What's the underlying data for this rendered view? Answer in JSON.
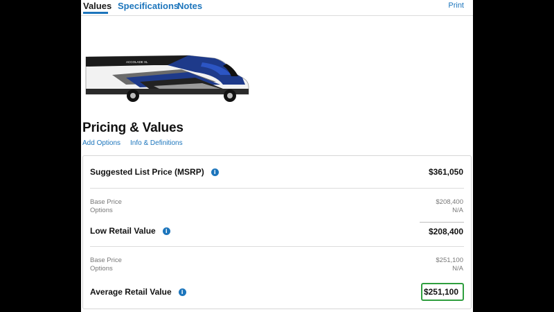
{
  "tabs": [
    {
      "label": "Values",
      "active": true
    },
    {
      "label": "Specifications",
      "active": false
    },
    {
      "label": "Notes",
      "active": false
    }
  ],
  "print_label": "Print",
  "vehicle_image": {
    "brand_text": "ACCOLADE XL"
  },
  "page_title": "Pricing & Values",
  "links": {
    "add_options": "Add Options",
    "info_definitions": "Info & Definitions"
  },
  "pricing": {
    "msrp": {
      "label": "Suggested List Price (MSRP)",
      "value": "$361,050"
    },
    "low": {
      "base_label": "Base Price",
      "base_value": "$208,400",
      "options_label": "Options",
      "options_value": "N/A",
      "label": "Low Retail Value",
      "value": "$208,400"
    },
    "average": {
      "base_label": "Base Price",
      "base_value": "$251,100",
      "options_label": "Options",
      "options_value": "N/A",
      "label": "Average Retail Value",
      "value": "$251,100"
    }
  },
  "colors": {
    "accent": "#1c75bc",
    "highlight": "#2e9e3e"
  }
}
